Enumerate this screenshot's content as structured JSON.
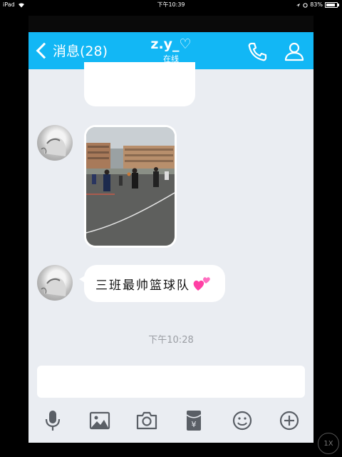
{
  "status_bar": {
    "device": "iPad",
    "time": "下午10:39",
    "battery": "83%",
    "battery_level": 0.83
  },
  "nav": {
    "back_label": "消息(28)",
    "title": "z.y_♡",
    "subtitle": "在线"
  },
  "messages": {
    "text_message": "三班最帅篮球队",
    "timestamp": "下午10:28"
  },
  "input": {
    "placeholder": ""
  },
  "toolbar_icons": [
    "microphone-icon",
    "image-icon",
    "camera-icon",
    "red-packet-icon",
    "emoji-icon",
    "plus-icon"
  ],
  "zoom_button": "1X",
  "colors": {
    "nav_bar": "#12b7f5",
    "chat_background": "#eaedf2",
    "toolbar_icon": "#5a5f66"
  }
}
